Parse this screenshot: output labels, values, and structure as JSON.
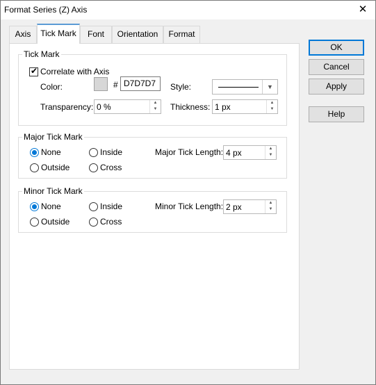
{
  "window": {
    "title": "Format Series (Z) Axis",
    "close_glyph": "✕"
  },
  "tabs": [
    {
      "label": "Axis"
    },
    {
      "label": "Tick Mark",
      "active": true
    },
    {
      "label": "Font"
    },
    {
      "label": "Orientation"
    },
    {
      "label": "Format"
    }
  ],
  "tick_mark": {
    "group_title": "Tick Mark",
    "correlate_label": "Correlate with Axis",
    "correlate_checked": true,
    "color_label": "Color:",
    "color_swatch": "#D7D7D7",
    "hash": "#",
    "color_value": "D7D7D7",
    "style_label": "Style:",
    "transparency_label": "Transparency:",
    "transparency_value": "0 %",
    "thickness_label": "Thickness:",
    "thickness_value": "1 px"
  },
  "major": {
    "group_title": "Major Tick Mark",
    "options": [
      "None",
      "Inside",
      "Outside",
      "Cross"
    ],
    "selected": "None",
    "length_label": "Major Tick Length:",
    "length_value": "4 px"
  },
  "minor": {
    "group_title": "Minor Tick Mark",
    "options": [
      "None",
      "Inside",
      "Outside",
      "Cross"
    ],
    "selected": "None",
    "length_label": "Minor Tick Length:",
    "length_value": "2 px"
  },
  "buttons": {
    "ok": "OK",
    "cancel": "Cancel",
    "apply": "Apply",
    "help": "Help"
  },
  "colors": {
    "accent": "#0078d7",
    "tab_highlight": "#5b9bd5"
  }
}
